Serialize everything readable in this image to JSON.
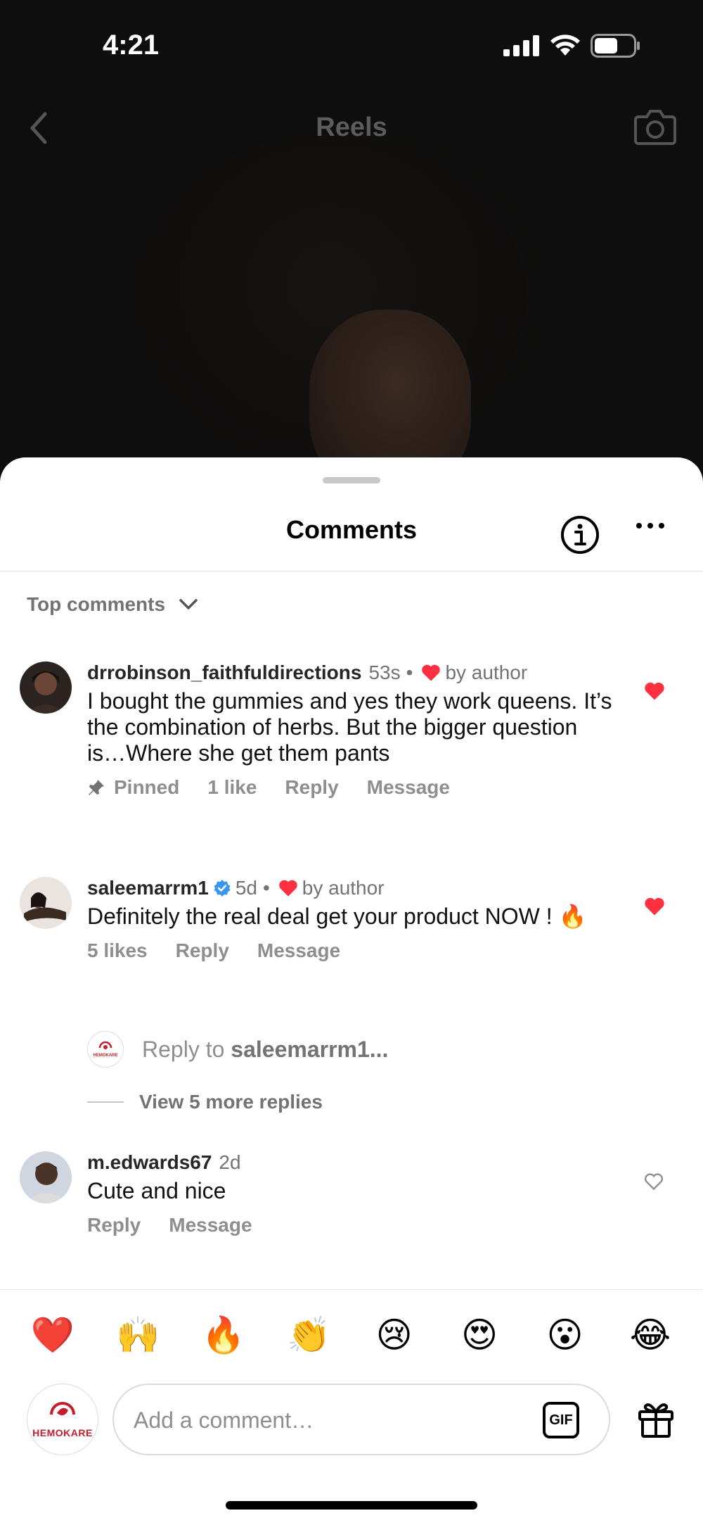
{
  "status_bar": {
    "time": "4:21"
  },
  "nav": {
    "title": "Reels"
  },
  "sheet": {
    "title": "Comments",
    "sort_label": "Top comments"
  },
  "comments": [
    {
      "username": "drrobinson_faithfuldirections",
      "time": "53s",
      "liked_by_author": "by author",
      "text": "I bought the gummies and yes they work queens. It’s the combination of herbs. But the bigger question is…Where she get them pants",
      "pinned_label": "Pinned",
      "likes": "1 like",
      "reply_label": "Reply",
      "message_label": "Message",
      "liked": true
    },
    {
      "username": "saleemarrm1",
      "time": "5d",
      "liked_by_author": "by author",
      "text": "Definitely the real deal get your product NOW ! 🔥",
      "likes": "5 likes",
      "reply_label": "Reply",
      "message_label": "Message",
      "liked": true,
      "verified": true
    },
    {
      "username": "m.edwards67",
      "time": "2d",
      "text": "Cute and nice",
      "reply_label": "Reply",
      "message_label": "Message",
      "liked": false
    }
  ],
  "reply_prompt": {
    "prefix": "Reply to ",
    "target": "saleemarrm1..."
  },
  "view_more": "View 5 more replies",
  "emoji_reactions": [
    "❤️",
    "🙌",
    "🔥",
    "👏",
    "😢",
    "😍",
    "😮",
    "😂"
  ],
  "composer": {
    "placeholder": "Add a comment…",
    "gif_label": "GIF",
    "avatar_brand": "HEMOKARE"
  },
  "colors": {
    "like_red": "#ff3040",
    "verified_blue": "#3897f0",
    "brand_red": "#c41f2a"
  }
}
